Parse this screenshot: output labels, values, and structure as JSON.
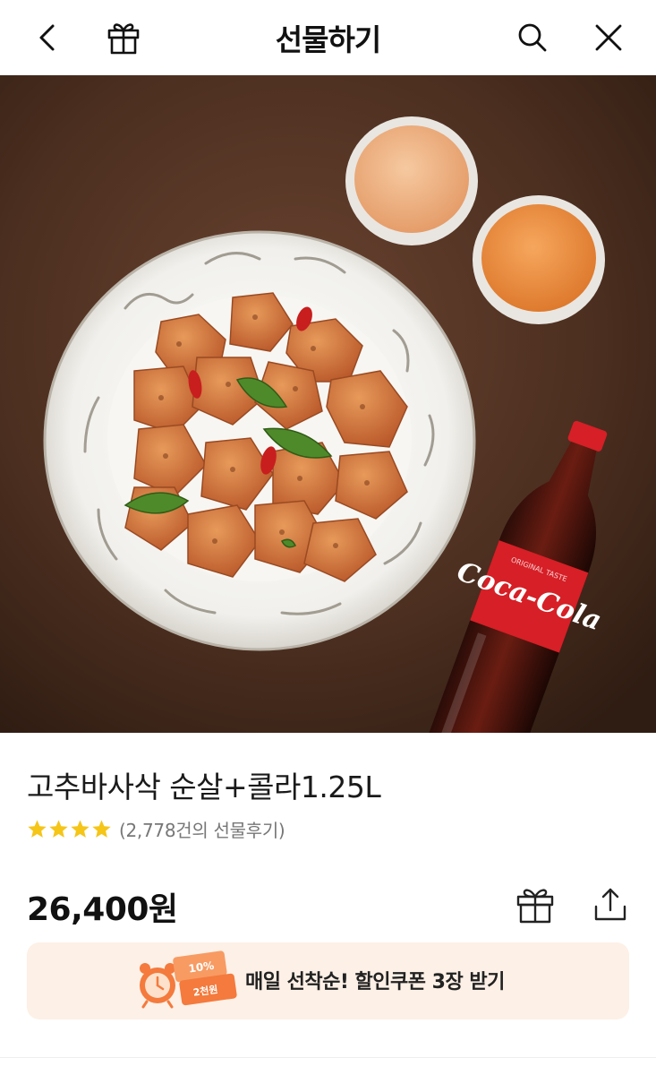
{
  "header": {
    "title": "선물하기",
    "icons": {
      "back": "chevron-left-icon",
      "gift": "gift-icon",
      "search": "search-icon",
      "close": "close-icon"
    }
  },
  "hero": {
    "bottle_label_text": "Coca-Cola",
    "bottle_label_small": "ORIGINAL TASTE"
  },
  "product": {
    "name": "고추바사삭 순살+콜라1.25L",
    "stars_filled": 4,
    "stars_total": 4,
    "review_text": "(2,778건의 선물후기)",
    "price": "26,400원"
  },
  "coupon": {
    "badge_percent": "10%",
    "badge_amount": "2천원",
    "text": "매일 선착순! 할인쿠폰 3장 받기"
  },
  "colors": {
    "star": "#f5c518",
    "coupon_bg": "#fdf0e6",
    "coupon_accent": "#f47a3d",
    "text_dark": "#111111",
    "text_muted": "#777777"
  }
}
